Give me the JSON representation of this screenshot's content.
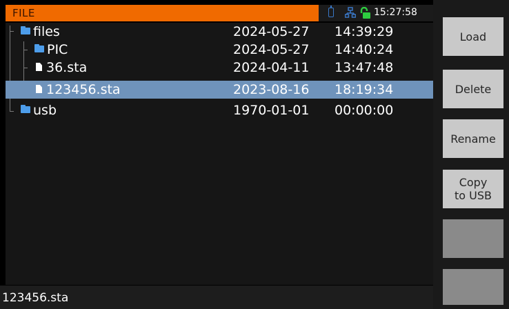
{
  "header": {
    "title": "FILE",
    "time": "15:27:58",
    "icons": [
      "usb-icon",
      "network-icon",
      "unlock-icon"
    ],
    "colors": {
      "title_bar": "#f06a00",
      "lock": "#2ecc40",
      "network": "#3a78c8",
      "selection": "#6f93bb"
    }
  },
  "tree": {
    "rows": [
      {
        "name": "files",
        "type": "folder",
        "date": "2024-05-27",
        "time": "14:39:29",
        "selected": false
      },
      {
        "name": "PIC",
        "type": "folder",
        "date": "2024-05-27",
        "time": "14:40:24",
        "selected": false
      },
      {
        "name": "36.sta",
        "type": "file",
        "date": "2024-04-11",
        "time": "13:47:48",
        "selected": false
      },
      {
        "name": "123456.sta",
        "type": "file",
        "date": "2023-08-16",
        "time": "18:19:34",
        "selected": true
      },
      {
        "name": "usb",
        "type": "folder",
        "date": "1970-01-01",
        "time": "00:00:00",
        "selected": false
      }
    ]
  },
  "status": {
    "selected_file": "123456.sta"
  },
  "buttons": {
    "load": "Load",
    "delete": "Delete",
    "rename": "Rename",
    "copy_line1": "Copy",
    "copy_line2": "to USB"
  }
}
